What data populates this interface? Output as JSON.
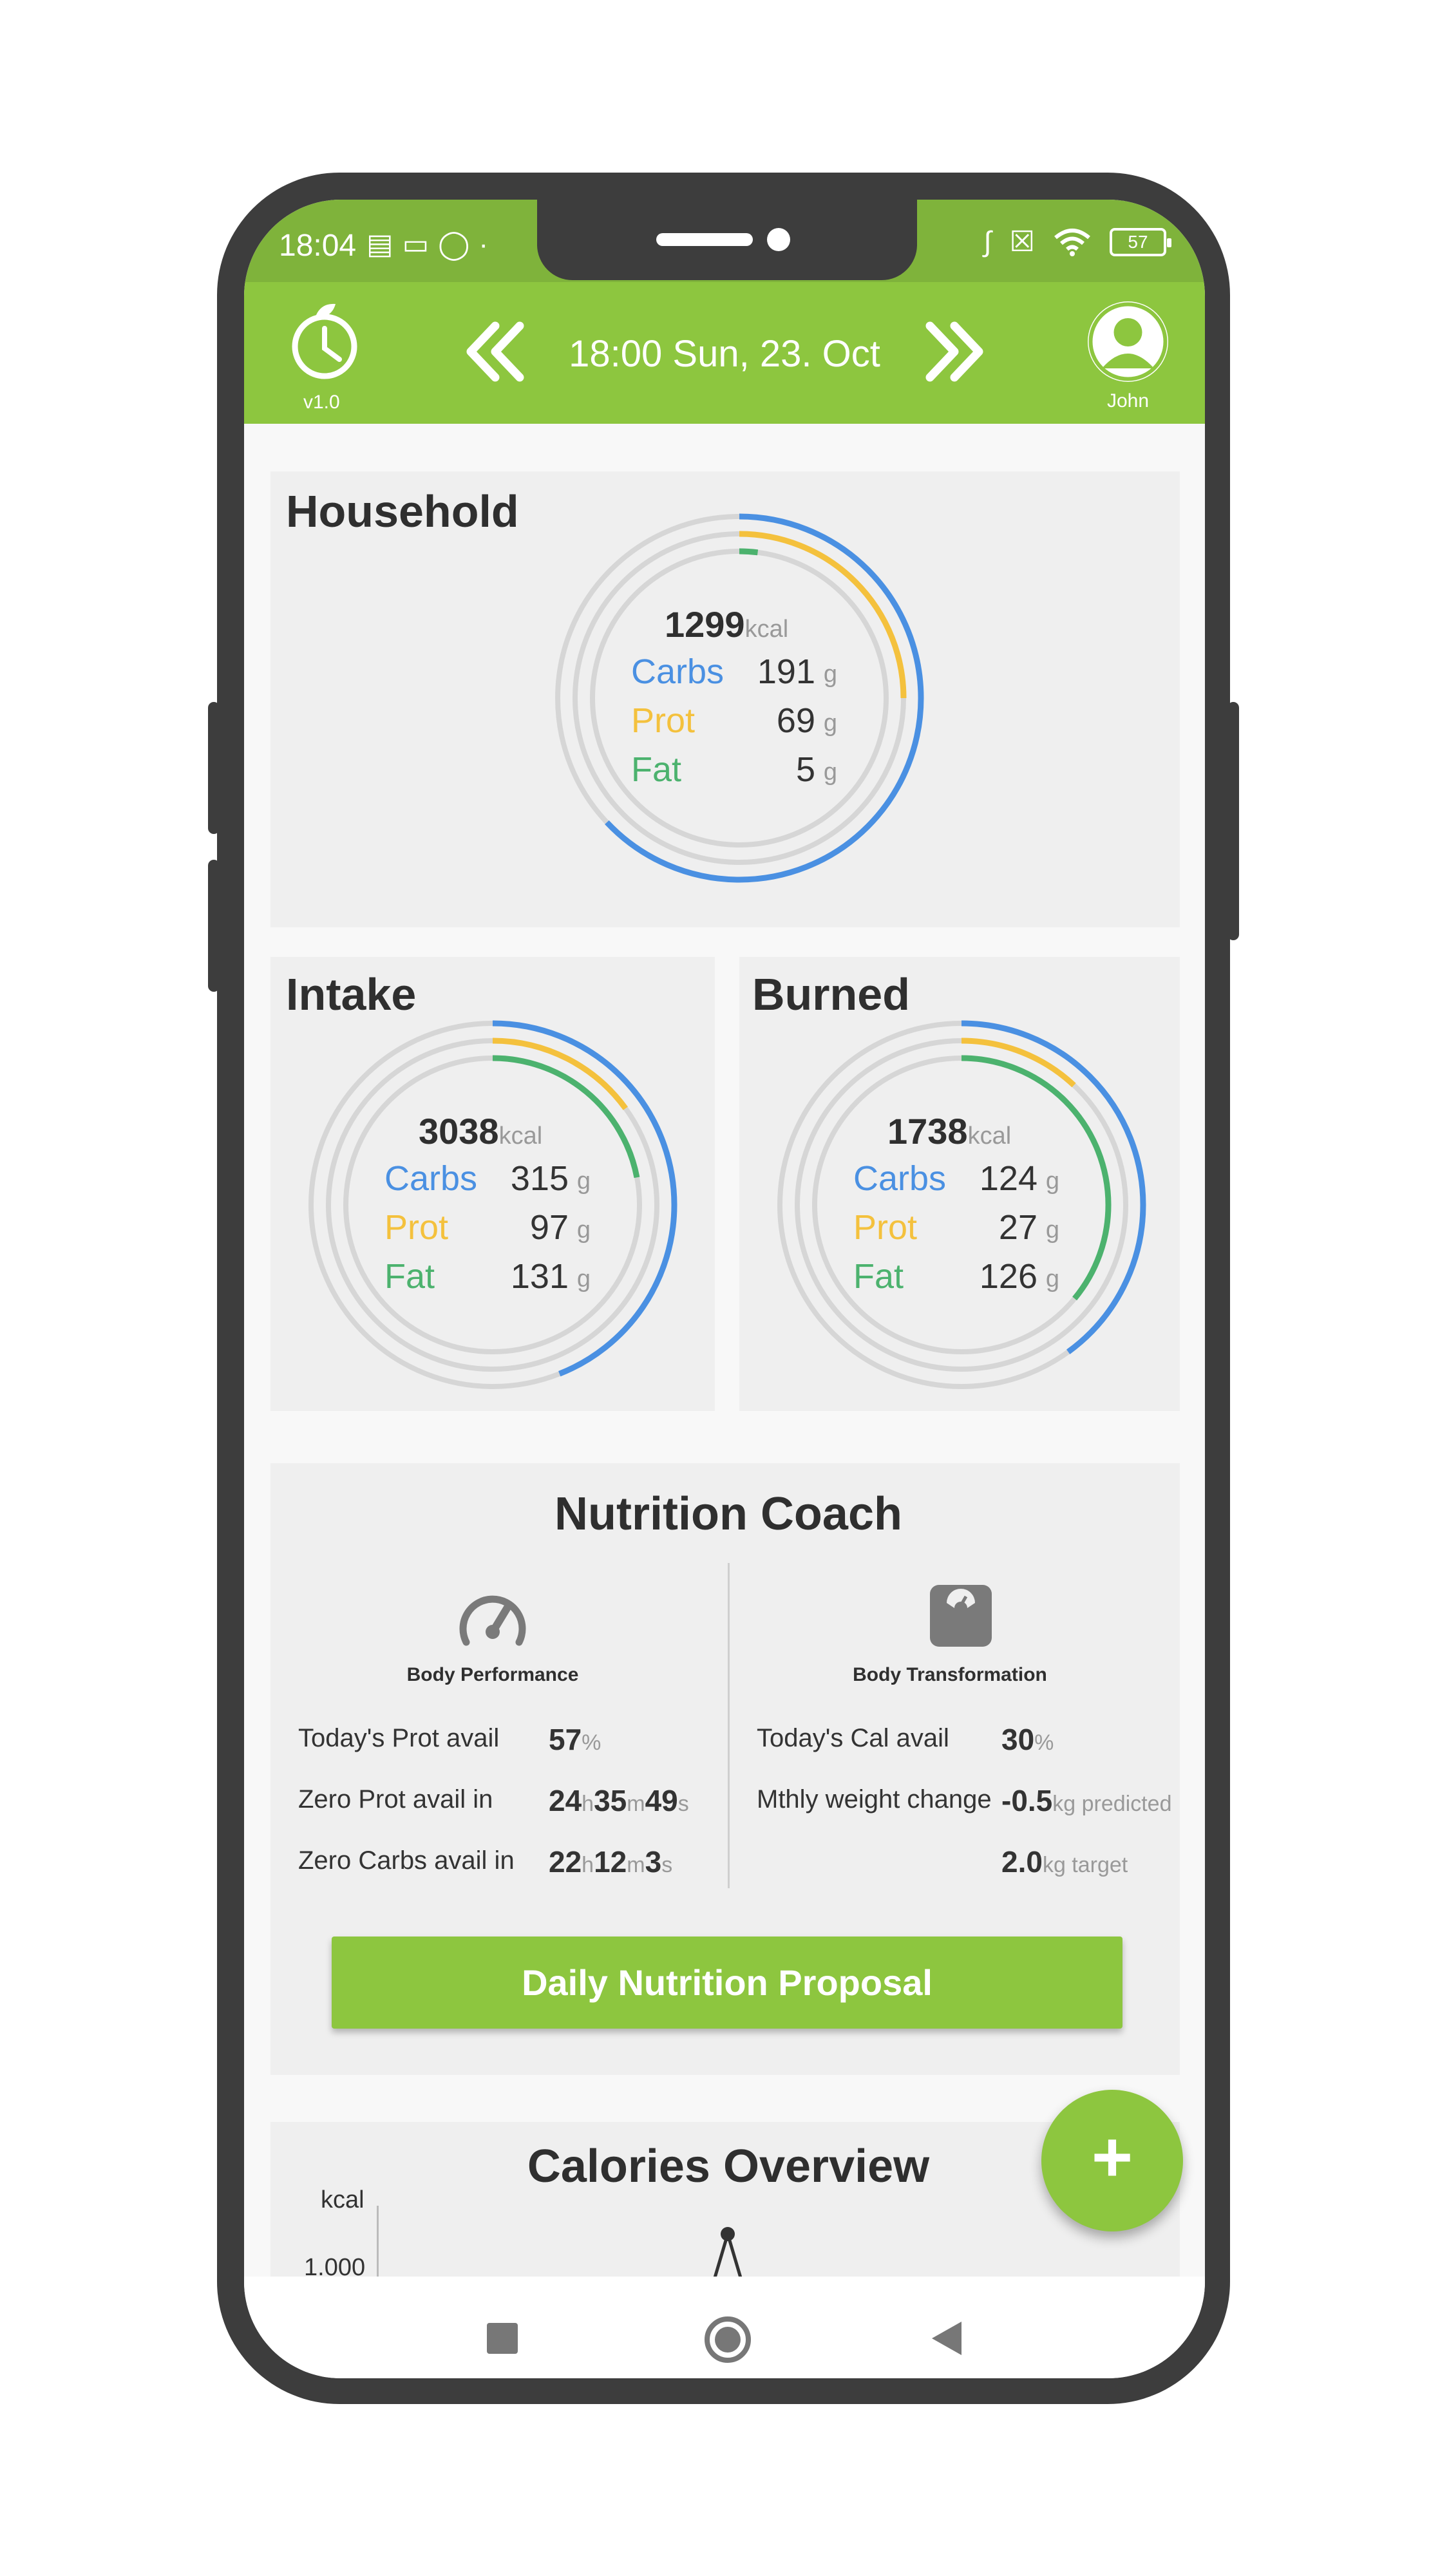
{
  "status_bar": {
    "time": "18:04",
    "left_icons": [
      "notification-icon",
      "laptop-icon",
      "bulb-icon",
      "dot-icon"
    ],
    "right_icons": [
      "bluetooth-icon",
      "no-sim-icon",
      "wifi-icon"
    ],
    "battery": "57"
  },
  "header": {
    "version": "v1.0",
    "date": "18:00 Sun, 23. Oct",
    "user": "John",
    "accent_color": "#8dc63f"
  },
  "household": {
    "title": "Household",
    "kcal": "1299",
    "kcal_unit": "kcal",
    "carbs_label": "Carbs",
    "carbs": "191",
    "carbs_unit": "g",
    "prot_label": "Prot",
    "prot": "69",
    "prot_unit": "g",
    "fat_label": "Fat",
    "fat": "5",
    "fat_unit": "g",
    "rings": {
      "carbs": 0.63,
      "prot": 0.25,
      "fat": 0.02
    }
  },
  "intake": {
    "title": "Intake",
    "kcal": "3038",
    "kcal_unit": "kcal",
    "carbs_label": "Carbs",
    "carbs": "315",
    "carbs_unit": "g",
    "prot_label": "Prot",
    "prot": "97",
    "prot_unit": "g",
    "fat_label": "Fat",
    "fat": "131",
    "fat_unit": "g",
    "rings": {
      "carbs": 0.44,
      "prot": 0.15,
      "fat": 0.22
    }
  },
  "burned": {
    "title": "Burned",
    "kcal": "1738",
    "kcal_unit": "kcal",
    "carbs_label": "Carbs",
    "carbs": "124",
    "carbs_unit": "g",
    "prot_label": "Prot",
    "prot": "27",
    "prot_unit": "g",
    "fat_label": "Fat",
    "fat": "126",
    "fat_unit": "g",
    "rings": {
      "carbs": 0.4,
      "prot": 0.12,
      "fat": 0.36
    }
  },
  "colors": {
    "carbs": "#4a90e2",
    "prot": "#f4c13d",
    "fat": "#4cb26e",
    "track": "#d6d6d6"
  },
  "coach": {
    "title": "Nutrition Coach",
    "left_heading": "Body Performance",
    "right_heading": "Body Transformation",
    "prot_avail_label": "Today's Prot avail",
    "prot_avail_value": "57",
    "prot_avail_unit": "%",
    "zero_prot_label": "Zero Prot avail in",
    "zero_prot_h": "24",
    "zero_prot_m": "35",
    "zero_prot_s": "49",
    "zero_carbs_label": "Zero Carbs avail in",
    "zero_carbs_h": "22",
    "zero_carbs_m": "12",
    "zero_carbs_s": "3",
    "unit_h": "h",
    "unit_m": "m",
    "unit_s": "s",
    "cal_avail_label": "Today's Cal avail",
    "cal_avail_value": "30",
    "cal_avail_unit": "%",
    "weight_change_label": "Mthly weight change",
    "weight_predicted_value": "-0.5",
    "weight_predicted_unit": "kg predicted",
    "weight_target_value": "2.0",
    "weight_target_unit": "kg target",
    "proposal_button": "Daily Nutrition Proposal"
  },
  "calories_overview": {
    "title": "Calories Overview",
    "unit": "kcal",
    "tick": "1.000"
  },
  "fab_label": "+"
}
